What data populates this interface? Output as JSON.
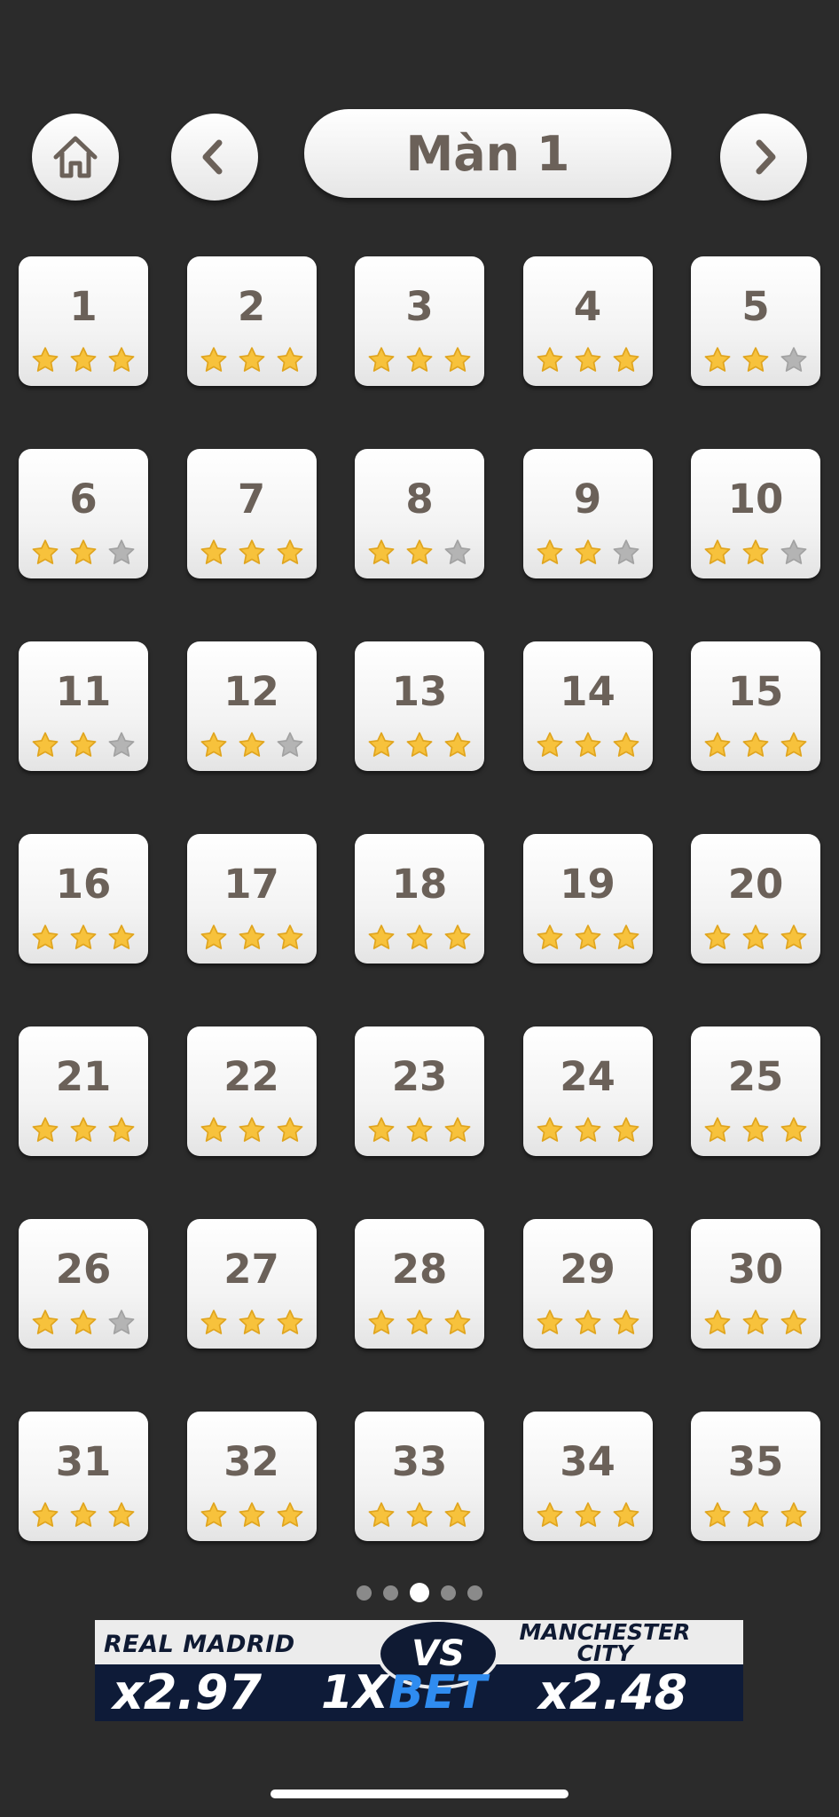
{
  "nav": {
    "home_icon": "home-icon",
    "prev_icon": "chevron-left-icon",
    "next_icon": "chevron-right-icon",
    "title": "Màn 1"
  },
  "colors": {
    "background": "#2b2b2b",
    "star_filled": "#f7c23c",
    "star_empty": "#b4b4b4",
    "text": "#6b6159"
  },
  "levels": [
    {
      "number": "1",
      "stars": 3
    },
    {
      "number": "2",
      "stars": 3
    },
    {
      "number": "3",
      "stars": 3
    },
    {
      "number": "4",
      "stars": 3
    },
    {
      "number": "5",
      "stars": 2
    },
    {
      "number": "6",
      "stars": 2
    },
    {
      "number": "7",
      "stars": 3
    },
    {
      "number": "8",
      "stars": 2
    },
    {
      "number": "9",
      "stars": 2
    },
    {
      "number": "10",
      "stars": 2
    },
    {
      "number": "11",
      "stars": 2
    },
    {
      "number": "12",
      "stars": 2
    },
    {
      "number": "13",
      "stars": 3
    },
    {
      "number": "14",
      "stars": 3
    },
    {
      "number": "15",
      "stars": 3
    },
    {
      "number": "16",
      "stars": 3
    },
    {
      "number": "17",
      "stars": 3
    },
    {
      "number": "18",
      "stars": 3
    },
    {
      "number": "19",
      "stars": 3
    },
    {
      "number": "20",
      "stars": 3
    },
    {
      "number": "21",
      "stars": 3
    },
    {
      "number": "22",
      "stars": 3
    },
    {
      "number": "23",
      "stars": 3
    },
    {
      "number": "24",
      "stars": 3
    },
    {
      "number": "25",
      "stars": 3
    },
    {
      "number": "26",
      "stars": 2
    },
    {
      "number": "27",
      "stars": 3
    },
    {
      "number": "28",
      "stars": 3
    },
    {
      "number": "29",
      "stars": 3
    },
    {
      "number": "30",
      "stars": 3
    },
    {
      "number": "31",
      "stars": 3
    },
    {
      "number": "32",
      "stars": 3
    },
    {
      "number": "33",
      "stars": 3
    },
    {
      "number": "34",
      "stars": 3
    },
    {
      "number": "35",
      "stars": 3
    }
  ],
  "pagination": {
    "pages": 5,
    "active": 3
  },
  "ad": {
    "team_left": "REAL MADRID",
    "vs": "VS",
    "team_right_line1": "MANCHESTER",
    "team_right_line2": "CITY",
    "odds_left": "x2.97",
    "brand_part1": "1X",
    "brand_part2": "BET",
    "odds_right": "x2.48"
  }
}
